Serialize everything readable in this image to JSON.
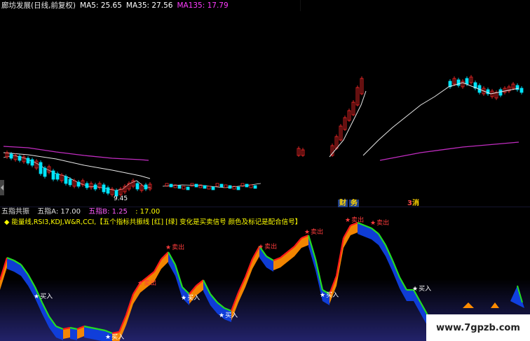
{
  "title_bar": {
    "stock_title": "廊坊发展(日线,前复权)",
    "ma5": "MA5: 25.65",
    "ma35": "MA35: 27.56",
    "ma135": "MA135: 17.79"
  },
  "price_chart": {
    "low_label": "9.45",
    "sub_label_1": "财",
    "sub_label_2": "务",
    "sub_label_3": "3",
    "sub_label_4": "消",
    "colors": {
      "up": "#ff2a2a",
      "down": "#00e5ff",
      "ma_white": "#e8e8e8",
      "ma_purple": "#c02cc0"
    }
  },
  "indicator_header": {
    "name": "五指共振",
    "a_label": "五指A: 17.00",
    "b_label": "五指B: 1.25",
    "b_extra": ": 17.00"
  },
  "description": "能量线,RSI3,KDJ,W&R,CCI,【五个指标共振线 [红] [绿] 变化是买卖信号 颜色及标记是配合信号】",
  "signals": {
    "sell": "卖出",
    "buy": "买入",
    "star": "★"
  },
  "watermark": "www.7gpzb.com",
  "colors": {
    "orange": "#ff8c00",
    "blue": "#1040e0",
    "red": "#ff1a1a",
    "green": "#22dd22",
    "yellow": "#ffff00"
  }
}
